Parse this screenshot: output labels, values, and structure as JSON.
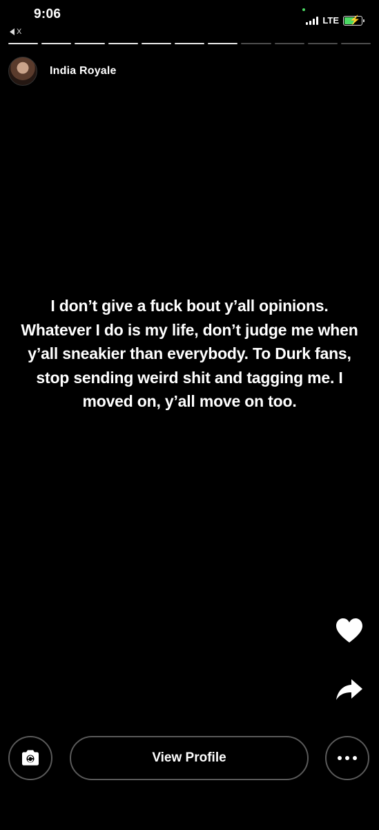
{
  "status_bar": {
    "time": "9:06",
    "back_app_label": "X",
    "network": "LTE",
    "signal_icon": "cellular-signal-icon",
    "battery_icon": "battery-charging-icon",
    "battery_level": 0.55,
    "accent_green": "#4cd964"
  },
  "story": {
    "segments_total": 11,
    "segments_viewed": 7,
    "username": "India Royale",
    "avatar_icon": "profile-avatar",
    "text": "I don’t give a fuck bout y’all opinions. Whatever I do is my life, don’t judge me when y’all sneakier than everybody. To Durk fans, stop sending weird shit and tagging me. I moved on, y’all move on too."
  },
  "actions": {
    "like_icon": "heart-icon",
    "share_icon": "share-arrow-icon",
    "camera_icon": "camera-reply-icon",
    "view_profile_label": "View Profile",
    "more_icon": "more-options-icon"
  },
  "colors": {
    "background": "#000000",
    "text": "#ffffff",
    "button_border": "#5a5a5a"
  }
}
